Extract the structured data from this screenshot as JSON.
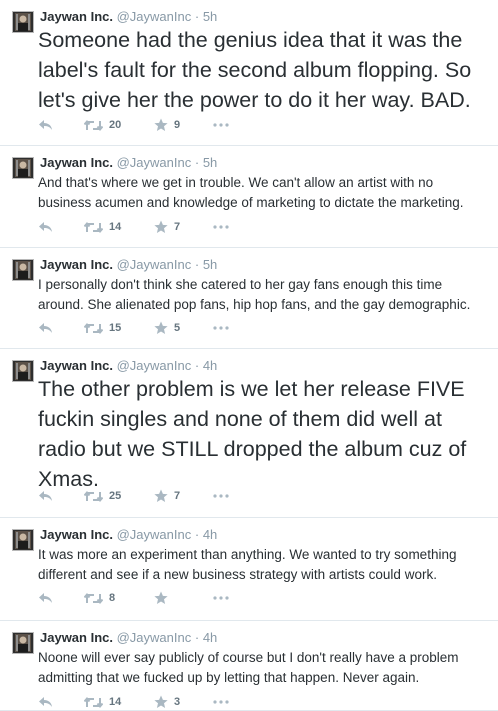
{
  "tweets": [
    {
      "name": "Jaywan Inc.",
      "handle": "@JaywanInc",
      "separator": "·",
      "time": "5h",
      "text": "Someone had the genius idea that it was the label's fault for the second album flopping. So let's give her the power to do it her way. BAD.",
      "retweets": "20",
      "favorites": "9"
    },
    {
      "name": "Jaywan Inc.",
      "handle": "@JaywanInc",
      "separator": "·",
      "time": "5h",
      "text": "And that's where we get in trouble. We can't allow an artist with no business acumen and knowledge of marketing to dictate the marketing.",
      "retweets": "14",
      "favorites": "7"
    },
    {
      "name": "Jaywan Inc.",
      "handle": "@JaywanInc",
      "separator": "·",
      "time": "5h",
      "text": "I personally don't think she catered to her gay fans enough this time around. She alienated pop fans, hip hop fans, and the gay demographic.",
      "retweets": "15",
      "favorites": "5"
    },
    {
      "name": "Jaywan Inc.",
      "handle": "@JaywanInc",
      "separator": "·",
      "time": "4h",
      "text": "The other problem is we let her release FIVE fuckin singles and none of them did well at radio but we STILL dropped the album cuz of Xmas.",
      "retweets": "25",
      "favorites": "7"
    },
    {
      "name": "Jaywan Inc.",
      "handle": "@JaywanInc",
      "separator": "·",
      "time": "4h",
      "text": "It was more an experiment than anything. We wanted to try something different and see if a new business strategy with artists could work.",
      "retweets": "8",
      "favorites": ""
    },
    {
      "name": "Jaywan Inc.",
      "handle": "@JaywanInc",
      "separator": "·",
      "time": "4h",
      "text": "Noone will ever say publicly of course but I don't really have a problem admitting that we fucked up by letting that happen. Never again.",
      "retweets": "14",
      "favorites": "3"
    }
  ],
  "icons": {
    "reply": "reply-icon",
    "retweet": "retweet-icon",
    "favorite": "star-icon",
    "more": "more-icon"
  },
  "colors": {
    "text": "#292f33",
    "meta": "#8899a6",
    "icon": "#aab8c2",
    "divider": "#e1e8ed"
  }
}
